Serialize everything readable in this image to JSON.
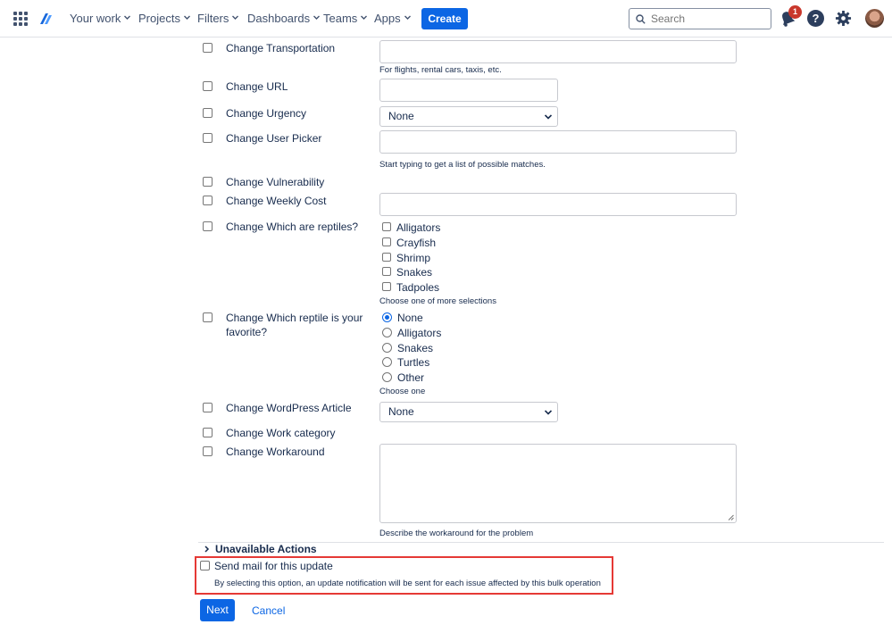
{
  "nav": {
    "items": [
      {
        "label": "Your work"
      },
      {
        "label": "Projects"
      },
      {
        "label": "Filters"
      },
      {
        "label": "Dashboards"
      },
      {
        "label": "Teams"
      },
      {
        "label": "Apps"
      }
    ],
    "create_label": "Create",
    "search_placeholder": "Search",
    "notification_count": "1",
    "help_glyph": "?"
  },
  "icons": {
    "app_switcher": "grid-icon",
    "logo": "jira-logo-icon",
    "search": "search-icon",
    "notifications": "bell-icon",
    "help": "help-icon",
    "settings": "gear-icon",
    "profile": "avatar"
  },
  "colors": {
    "accent": "#0c66e4",
    "text": "#172b4d",
    "highlight": "#e53935",
    "badge": "#c9372c"
  },
  "form": {
    "rows": [
      {
        "label": "Change Transportation",
        "help": "For flights, rental cars, taxis, etc."
      },
      {
        "label": "Change URL"
      },
      {
        "label": "Change Urgency",
        "select_value": "None"
      },
      {
        "label": "Change User Picker",
        "help": "Start typing to get a list of possible matches."
      },
      {
        "label": "Change Vulnerability"
      },
      {
        "label": "Change Weekly Cost"
      },
      {
        "label": "Change Which are reptiles?",
        "options": [
          "Alligators",
          "Crayfish",
          "Shrimp",
          "Snakes",
          "Tadpoles"
        ],
        "help": "Choose one of more selections"
      },
      {
        "label_line1": "Change Which reptile is your",
        "label_line2": "favorite?",
        "options": [
          "None",
          "Alligators",
          "Snakes",
          "Turtles",
          "Other"
        ],
        "selected": "None",
        "help": "Choose one"
      },
      {
        "label": "Change WordPress Article",
        "select_value": "None"
      },
      {
        "label": "Change Work category"
      },
      {
        "label": "Change Workaround",
        "help": "Describe the workaround for the problem"
      }
    ]
  },
  "unavailable_actions": "Unavailable Actions",
  "send_mail": {
    "label": "Send mail for this update",
    "help": "By selecting this option, an update notification will be sent for each issue affected by this bulk operation"
  },
  "actions": {
    "next": "Next",
    "cancel": "Cancel"
  }
}
